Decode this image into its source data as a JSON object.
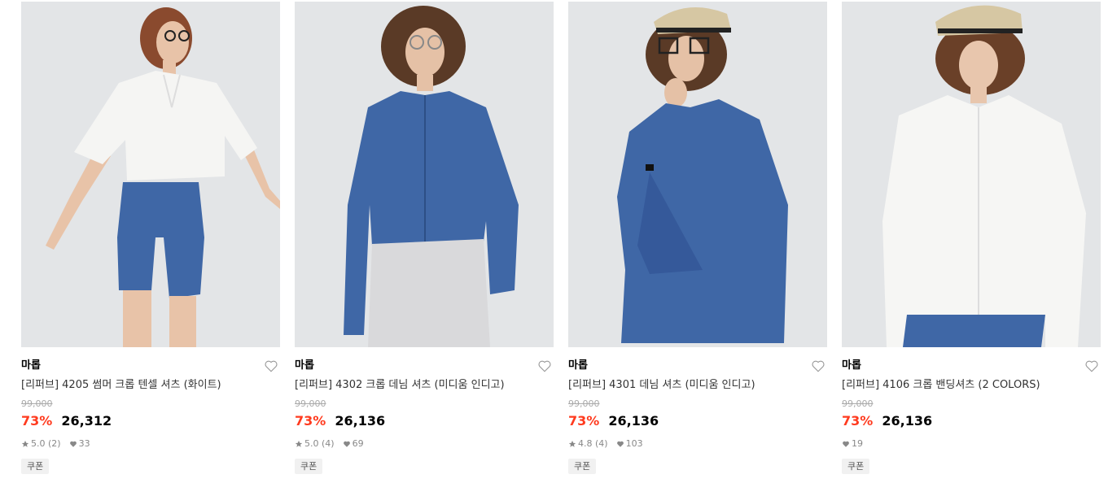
{
  "products": [
    {
      "brand": "마롭",
      "title": "[리퍼브] 4205 썸머 크롭 텐셀 셔츠 (화이트)",
      "original_price": "99,000",
      "discount": "73%",
      "price": "26,312",
      "rating": "5.0 (2)",
      "likes": "33",
      "badge": "쿠폰",
      "image_icon": "product-photo-white-shirt-denim-shorts"
    },
    {
      "brand": "마롭",
      "title": "[리퍼브] 4302 크롭 데님 셔츠 (미디움 인디고)",
      "original_price": "99,000",
      "discount": "73%",
      "price": "26,136",
      "rating": "5.0 (4)",
      "likes": "69",
      "badge": "쿠폰",
      "image_icon": "product-photo-denim-shirt-gray-skirt"
    },
    {
      "brand": "마롭",
      "title": "[리퍼브] 4301 데님 셔츠 (미디움 인디고)",
      "original_price": "99,000",
      "discount": "73%",
      "price": "26,136",
      "rating": "4.8 (4)",
      "likes": "103",
      "badge": "쿠폰",
      "image_icon": "product-photo-denim-shirt-cap"
    },
    {
      "brand": "마롭",
      "title": "[리퍼브] 4106 크롭 밴딩셔츠 (2 COLORS)",
      "original_price": "99,000",
      "discount": "73%",
      "price": "26,136",
      "rating": "",
      "likes": "19",
      "badge": "쿠폰",
      "image_icon": "product-photo-white-shirt-cap"
    }
  ],
  "colors": {
    "discount": "#ff3b1f",
    "denim": "#3f67a6",
    "white_shirt": "#f5f5f3",
    "photo_bg": "#e6e7e9"
  }
}
